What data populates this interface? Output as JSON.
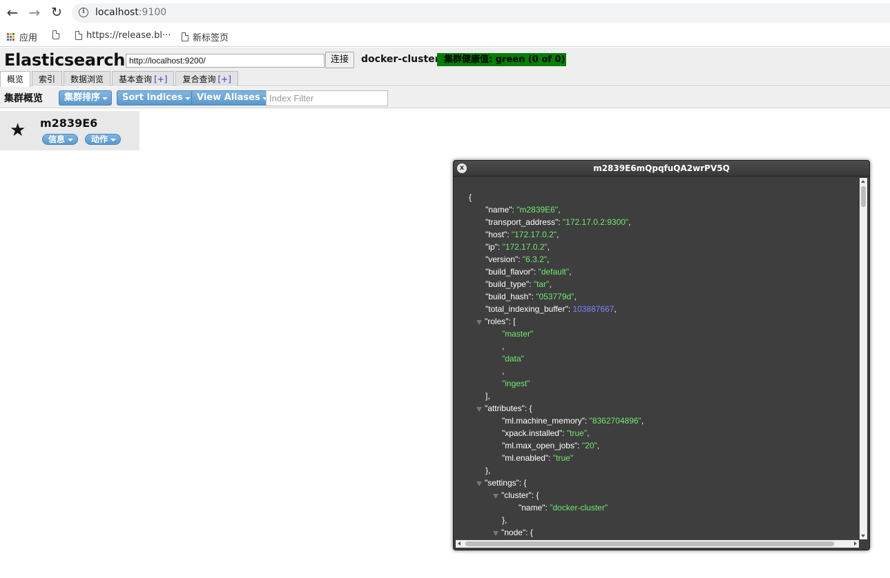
{
  "browser": {
    "url_host": "localhost",
    "url_port": ":9100",
    "bookmarks": [
      {
        "label": "应用"
      },
      {
        "label": ""
      },
      {
        "label": "https://release.bl···"
      },
      {
        "label": "新标签页"
      }
    ]
  },
  "app": {
    "title": "Elasticsearch",
    "connect_url": "http://localhost:9200/",
    "connect_label": "连接",
    "cluster_name": "docker-cluster",
    "health": "集群健康值: green (0 of 0)",
    "health_color": "#008000",
    "tabs": [
      {
        "label": "概览",
        "plus": ""
      },
      {
        "label": "索引",
        "plus": ""
      },
      {
        "label": "数据浏览",
        "plus": ""
      },
      {
        "label": "基本查询",
        "plus": "[+]"
      },
      {
        "label": "复合查询",
        "plus": "[+]"
      }
    ]
  },
  "toolbar": {
    "title": "集群概览",
    "sort_cluster": "集群排序",
    "sort_indices": "Sort Indices",
    "view_aliases": "View Aliases",
    "index_filter_placeholder": "Index Filter"
  },
  "node": {
    "name": "m2839E6",
    "info_label": "信息",
    "action_label": "动作"
  },
  "dialog": {
    "title": "m2839E6mQpqfuQA2wrPV5Q",
    "close_glyph": "x",
    "lines": [
      {
        "indent": 0,
        "parts": [
          {
            "t": "p",
            "v": "{"
          }
        ]
      },
      {
        "indent": 1,
        "parts": [
          {
            "t": "k",
            "v": "\"name\""
          },
          {
            "t": "p",
            "v": ": "
          },
          {
            "t": "s",
            "v": "\"m2839E6\""
          },
          {
            "t": "p",
            "v": ","
          }
        ]
      },
      {
        "indent": 1,
        "parts": [
          {
            "t": "k",
            "v": "\"transport_address\""
          },
          {
            "t": "p",
            "v": ": "
          },
          {
            "t": "s",
            "v": "\"172.17.0.2:9300\""
          },
          {
            "t": "p",
            "v": ","
          }
        ]
      },
      {
        "indent": 1,
        "parts": [
          {
            "t": "k",
            "v": "\"host\""
          },
          {
            "t": "p",
            "v": ": "
          },
          {
            "t": "s",
            "v": "\"172.17.0.2\""
          },
          {
            "t": "p",
            "v": ","
          }
        ]
      },
      {
        "indent": 1,
        "parts": [
          {
            "t": "k",
            "v": "\"ip\""
          },
          {
            "t": "p",
            "v": ": "
          },
          {
            "t": "s",
            "v": "\"172.17.0.2\""
          },
          {
            "t": "p",
            "v": ","
          }
        ]
      },
      {
        "indent": 1,
        "parts": [
          {
            "t": "k",
            "v": "\"version\""
          },
          {
            "t": "p",
            "v": ": "
          },
          {
            "t": "s",
            "v": "\"6.3.2\""
          },
          {
            "t": "p",
            "v": ","
          }
        ]
      },
      {
        "indent": 1,
        "parts": [
          {
            "t": "k",
            "v": "\"build_flavor\""
          },
          {
            "t": "p",
            "v": ": "
          },
          {
            "t": "s",
            "v": "\"default\""
          },
          {
            "t": "p",
            "v": ","
          }
        ]
      },
      {
        "indent": 1,
        "parts": [
          {
            "t": "k",
            "v": "\"build_type\""
          },
          {
            "t": "p",
            "v": ": "
          },
          {
            "t": "s",
            "v": "\"tar\""
          },
          {
            "t": "p",
            "v": ","
          }
        ]
      },
      {
        "indent": 1,
        "parts": [
          {
            "t": "k",
            "v": "\"build_hash\""
          },
          {
            "t": "p",
            "v": ": "
          },
          {
            "t": "s",
            "v": "\"053779d\""
          },
          {
            "t": "p",
            "v": ","
          }
        ]
      },
      {
        "indent": 1,
        "parts": [
          {
            "t": "k",
            "v": "\"total_indexing_buffer\""
          },
          {
            "t": "p",
            "v": ": "
          },
          {
            "t": "n",
            "v": "103887667"
          },
          {
            "t": "p",
            "v": ","
          }
        ]
      },
      {
        "indent": 1,
        "toggle": true,
        "parts": [
          {
            "t": "k",
            "v": "\"roles\""
          },
          {
            "t": "p",
            "v": ": ["
          }
        ]
      },
      {
        "indent": 2,
        "parts": [
          {
            "t": "s",
            "v": "\"master\""
          }
        ]
      },
      {
        "indent": 2,
        "parts": [
          {
            "t": "p",
            "v": ","
          }
        ]
      },
      {
        "indent": 2,
        "parts": [
          {
            "t": "s",
            "v": "\"data\""
          }
        ]
      },
      {
        "indent": 2,
        "parts": [
          {
            "t": "p",
            "v": ","
          }
        ]
      },
      {
        "indent": 2,
        "parts": [
          {
            "t": "s",
            "v": "\"ingest\""
          }
        ]
      },
      {
        "indent": 1,
        "parts": [
          {
            "t": "p",
            "v": "],"
          }
        ]
      },
      {
        "indent": 1,
        "toggle": true,
        "parts": [
          {
            "t": "k",
            "v": "\"attributes\""
          },
          {
            "t": "p",
            "v": ": {"
          }
        ]
      },
      {
        "indent": 2,
        "parts": [
          {
            "t": "k",
            "v": "\"ml.machine_memory\""
          },
          {
            "t": "p",
            "v": ": "
          },
          {
            "t": "s",
            "v": "\"8362704896\""
          },
          {
            "t": "p",
            "v": ","
          }
        ]
      },
      {
        "indent": 2,
        "parts": [
          {
            "t": "k",
            "v": "\"xpack.installed\""
          },
          {
            "t": "p",
            "v": ": "
          },
          {
            "t": "s",
            "v": "\"true\""
          },
          {
            "t": "p",
            "v": ","
          }
        ]
      },
      {
        "indent": 2,
        "parts": [
          {
            "t": "k",
            "v": "\"ml.max_open_jobs\""
          },
          {
            "t": "p",
            "v": ": "
          },
          {
            "t": "s",
            "v": "\"20\""
          },
          {
            "t": "p",
            "v": ","
          }
        ]
      },
      {
        "indent": 2,
        "parts": [
          {
            "t": "k",
            "v": "\"ml.enabled\""
          },
          {
            "t": "p",
            "v": ": "
          },
          {
            "t": "s",
            "v": "\"true\""
          }
        ]
      },
      {
        "indent": 1,
        "parts": [
          {
            "t": "p",
            "v": "},"
          }
        ]
      },
      {
        "indent": 1,
        "toggle": true,
        "parts": [
          {
            "t": "k",
            "v": "\"settings\""
          },
          {
            "t": "p",
            "v": ": {"
          }
        ]
      },
      {
        "indent": 2,
        "toggle": true,
        "parts": [
          {
            "t": "k",
            "v": "\"cluster\""
          },
          {
            "t": "p",
            "v": ": {"
          }
        ]
      },
      {
        "indent": 3,
        "parts": [
          {
            "t": "k",
            "v": "\"name\""
          },
          {
            "t": "p",
            "v": ": "
          },
          {
            "t": "s",
            "v": "\"docker-cluster\""
          }
        ]
      },
      {
        "indent": 2,
        "parts": [
          {
            "t": "p",
            "v": "},"
          }
        ]
      },
      {
        "indent": 2,
        "toggle": true,
        "parts": [
          {
            "t": "k",
            "v": "\"node\""
          },
          {
            "t": "p",
            "v": ": {"
          }
        ]
      }
    ]
  }
}
